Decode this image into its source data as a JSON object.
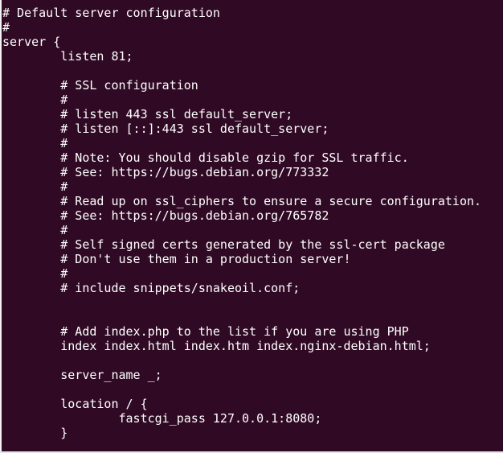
{
  "terminal": {
    "background": "#300a24",
    "foreground": "#ffffff",
    "lines": [
      "# Default server configuration",
      "#",
      "server {",
      "        listen 81;",
      "",
      "        # SSL configuration",
      "        #",
      "        # listen 443 ssl default_server;",
      "        # listen [::]:443 ssl default_server;",
      "        #",
      "        # Note: You should disable gzip for SSL traffic.",
      "        # See: https://bugs.debian.org/773332",
      "        #",
      "        # Read up on ssl_ciphers to ensure a secure configuration.",
      "        # See: https://bugs.debian.org/765782",
      "        #",
      "        # Self signed certs generated by the ssl-cert package",
      "        # Don't use them in a production server!",
      "        #",
      "        # include snippets/snakeoil.conf;",
      "",
      "",
      "        # Add index.php to the list if you are using PHP",
      "        index index.html index.htm index.nginx-debian.html;",
      "",
      "        server_name _;",
      "",
      "        location / {",
      "                fastcgi_pass 127.0.0.1:8080;",
      "        }"
    ]
  }
}
